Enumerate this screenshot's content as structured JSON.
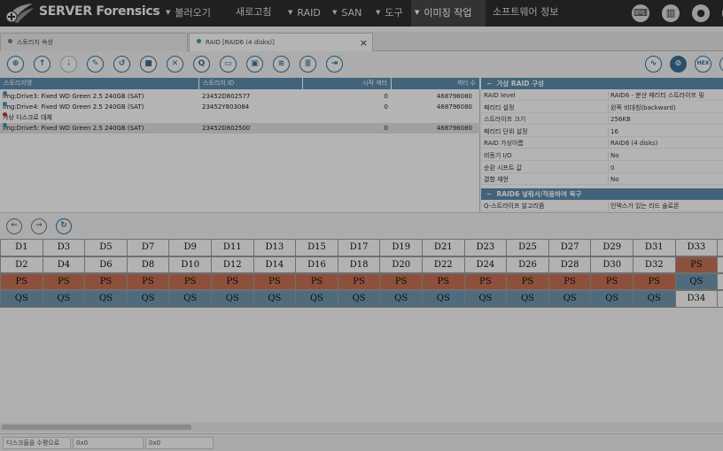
{
  "app": {
    "title": "SERVER Forensics"
  },
  "menu": [
    {
      "label": "불러오기",
      "dropdown": true
    },
    {
      "label": "새로고침",
      "dropdown": false
    },
    {
      "label": "RAID",
      "dropdown": true
    },
    {
      "label": "SAN",
      "dropdown": true
    },
    {
      "label": "도구",
      "dropdown": true
    },
    {
      "label": "이미징 작업",
      "dropdown": true,
      "active": true
    },
    {
      "label": "소프트웨어 정보",
      "dropdown": false
    }
  ],
  "top_icons": [
    "keyboard-icon",
    "panel-icon",
    "user-icon",
    "gear-icon"
  ],
  "tabs": [
    {
      "label": "스토리지 속성",
      "active": false,
      "dot_color": "#7a7a7a"
    },
    {
      "label": "RAID [RAID6 (4 disks)]",
      "active": true,
      "dot_color": "#3d9a8b",
      "close": "×"
    }
  ],
  "toolbar": {
    "left": [
      {
        "icon": "raid-icon",
        "glyph": "⊕"
      },
      {
        "icon": "arrow-up-icon",
        "glyph": "↑"
      },
      {
        "icon": "arrow-down-icon",
        "glyph": "↓",
        "disabled": true
      },
      {
        "icon": "edit-icon",
        "glyph": "✎"
      },
      {
        "icon": "undo-icon",
        "glyph": "↺"
      },
      {
        "icon": "stop-icon",
        "glyph": "■"
      },
      {
        "icon": "cancel-icon",
        "glyph": "✕"
      },
      {
        "icon": "query-icon",
        "glyph": "Q"
      },
      {
        "icon": "folder-icon",
        "glyph": "▭"
      },
      {
        "icon": "save-icon",
        "glyph": "▣"
      },
      {
        "icon": "layers-icon",
        "glyph": "≋"
      },
      {
        "icon": "stack-icon",
        "glyph": "≣"
      },
      {
        "icon": "export-icon",
        "glyph": "⇥"
      }
    ],
    "right": [
      {
        "icon": "waveform-icon",
        "glyph": "∿"
      },
      {
        "icon": "no-entry-icon",
        "glyph": "⊘",
        "selected": true
      },
      {
        "icon": "hex-icon",
        "glyph": "HEX"
      },
      {
        "icon": "expand-icon",
        "glyph": "⤢"
      }
    ]
  },
  "disk_table": {
    "columns": [
      "스토리지명",
      "스토리지 ID",
      "시작 섹터",
      "섹터 수"
    ],
    "rows": [
      {
        "name": "Img:Drive3: Fixed WD Green 2.5 240GB (SAT)",
        "id": "23452D802577",
        "start": "0",
        "count": "468796080",
        "dot": "#4c8fb6",
        "selected": false
      },
      {
        "name": "Img:Drive4: Fixed WD Green 2.5 240GB (SAT)",
        "id": "23452Y803084",
        "start": "0",
        "count": "468796080",
        "dot": "#4c8fb6",
        "selected": false
      },
      {
        "name": "가상 디스크로 대체",
        "id": "",
        "start": "",
        "count": "",
        "dot": "#c0392b",
        "selected": false
      },
      {
        "name": "Img:Drive5: Fixed WD Green 2.5 240GB (SAT)",
        "id": "23452D802500",
        "start": "0",
        "count": "468796080",
        "dot": "#4c8fb6",
        "selected": true
      }
    ]
  },
  "props": {
    "section1": "가상 RAID 구성",
    "rows": [
      {
        "k": "RAID level",
        "v": "RAID6 - 분산 패리티 스트라이프 및"
      },
      {
        "k": "패리티 설정",
        "v": "왼쪽 비대칭(backward)"
      },
      {
        "k": "스트라이프 크기",
        "v": "256KB"
      },
      {
        "k": "패리티 단위 설정",
        "v": "16"
      },
      {
        "k": "RAID 가상이름",
        "v": "RAID6 (4 disks)"
      },
      {
        "k": "비동기 I/O",
        "v": "No"
      },
      {
        "k": "순환 시프트 값",
        "v": "0"
      },
      {
        "k": "결함 재현",
        "v": "No"
      }
    ],
    "section2": "RAID6 넣춰서/적용하여 복구",
    "rows2": [
      {
        "k": "Q-스트라이프 알고리즘",
        "v": "인덱스가 있는 리드 솔로몬"
      }
    ]
  },
  "nav": [
    {
      "icon": "back-icon",
      "glyph": "←"
    },
    {
      "icon": "forward-icon",
      "glyph": "→"
    },
    {
      "icon": "refresh-icon",
      "glyph": "↻"
    }
  ],
  "grid": {
    "rows": [
      [
        "D1",
        "D3",
        "D5",
        "D7",
        "D9",
        "D11",
        "D13",
        "D15",
        "D17",
        "D19",
        "D21",
        "D23",
        "D25",
        "D27",
        "D29",
        "D31",
        "D33",
        ""
      ],
      [
        "D2",
        "D4",
        "D6",
        "D8",
        "D10",
        "D12",
        "D14",
        "D16",
        "D18",
        "D20",
        "D22",
        "D24",
        "D26",
        "D28",
        "D30",
        "D32",
        "PS",
        ""
      ],
      [
        "PS",
        "PS",
        "PS",
        "PS",
        "PS",
        "PS",
        "PS",
        "PS",
        "PS",
        "PS",
        "PS",
        "PS",
        "PS",
        "PS",
        "PS",
        "PS",
        "QS",
        ""
      ],
      [
        "QS",
        "QS",
        "QS",
        "QS",
        "QS",
        "QS",
        "QS",
        "QS",
        "QS",
        "QS",
        "QS",
        "QS",
        "QS",
        "QS",
        "QS",
        "QS",
        "D34",
        ""
      ]
    ]
  },
  "status": [
    {
      "label": "디스크들을 수평으로"
    },
    {
      "label": "0x0"
    },
    {
      "label": "0x0"
    }
  ],
  "colors": {
    "parity": "#c46f55",
    "q_parity": "#6f95ad",
    "header": "#5b89ab",
    "topbar": "#2d2d2d"
  }
}
